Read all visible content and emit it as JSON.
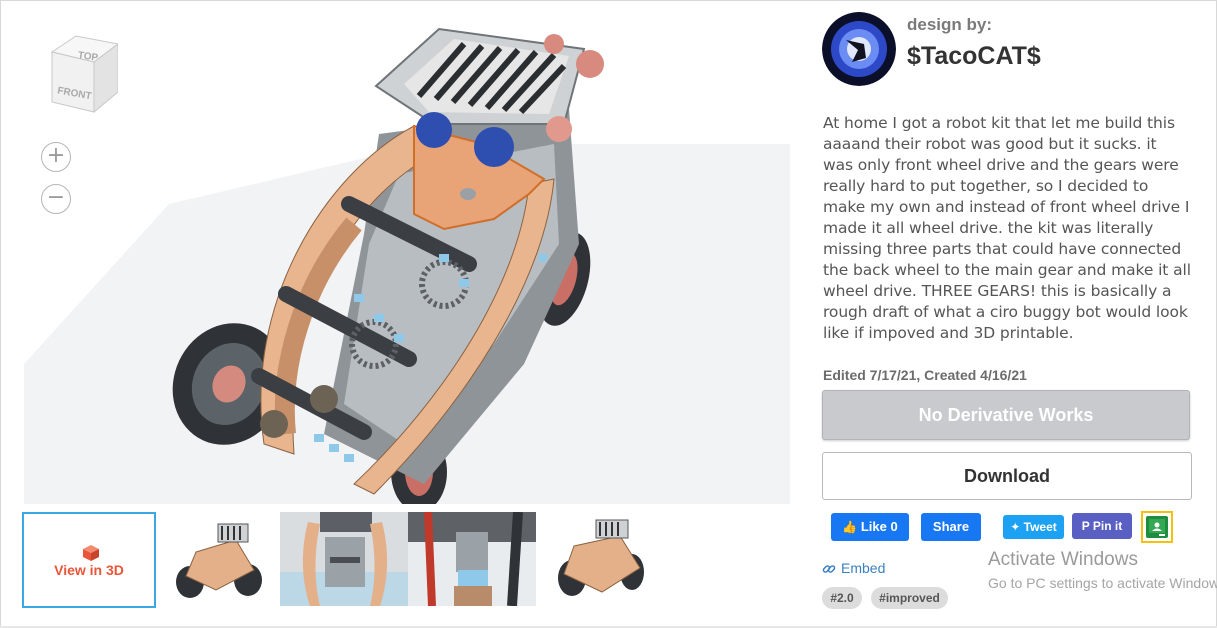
{
  "viewer": {
    "viewcube": {
      "top_label": "TOP",
      "front_label": "FRONT"
    },
    "zoom_in": "+",
    "zoom_out": "−"
  },
  "thumbnails": {
    "view_3d_label": "View in 3D",
    "count": 5
  },
  "author": {
    "design_by_label": "design by:",
    "name": "$TacoCAT$"
  },
  "description": "At home I got a robot kit that let me build this aaaand their robot was good but it sucks. it was only front wheel drive and the gears were really hard to put together, so I decided to make my own and instead of front wheel drive I made it all wheel drive. the kit was literally missing three parts that could have connected the back wheel to the main gear and make it all wheel drive. THREE GEARS! this is basically a rough draft of what a ciro buggy bot would look like if impoved and 3D printable.",
  "dates": "Edited 7/17/21, Created 4/16/21",
  "license_button": "No Derivative Works",
  "download_button": "Download",
  "share": {
    "like": "Like 0",
    "share": "Share",
    "tweet": "Tweet",
    "pin": "Pin it"
  },
  "embed_label": "Embed",
  "tags": [
    "#2.0",
    "#improved"
  ],
  "watermark": {
    "line1": "Activate Windows",
    "line2": "Go to PC settings to activate Windows."
  },
  "colors": {
    "accent_blue": "#3ba7e3",
    "view3d_orange": "#e8553a",
    "facebook": "#1877f2",
    "twitter": "#1da1f2",
    "pinterest": "#5a5fc4"
  }
}
